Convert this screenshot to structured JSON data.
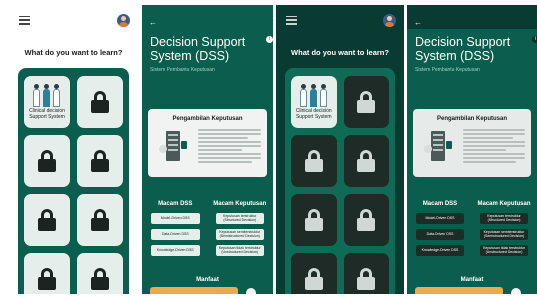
{
  "colors": {
    "primary": "#0b5e4d",
    "primary_dark": "#0a3b32",
    "panel_light": "#0f6a56",
    "tile_light": "#e5eeea",
    "tile_dark": "#1f2b27",
    "card_light": "#f1f3f2",
    "card_dark": "#e6ebe9",
    "text_dark": "#1a1a1a",
    "text_light": "#ffffff",
    "accent_orange": "#f1a84a",
    "sub_text": "#9ed2c4"
  },
  "screens": [
    {
      "theme": "light",
      "menu_icon": "hamburger-icon",
      "avatar_icon": "user-avatar",
      "heading": "What do you want to learn?",
      "tiles": [
        {
          "label": "Clinical decision Support System",
          "icon": "clinicians-illustration",
          "locked": false
        },
        {
          "label": "",
          "icon": "lock-icon",
          "locked": true
        },
        {
          "label": "",
          "icon": "lock-icon",
          "locked": true
        },
        {
          "label": "",
          "icon": "lock-icon",
          "locked": true
        },
        {
          "label": "",
          "icon": "lock-icon",
          "locked": true
        },
        {
          "label": "",
          "icon": "lock-icon",
          "locked": true
        },
        {
          "label": "",
          "icon": "lock-icon",
          "locked": true
        },
        {
          "label": "",
          "icon": "lock-icon",
          "locked": true
        }
      ]
    },
    {
      "theme": "light",
      "back_icon": "back-arrow-icon",
      "title": "Decision Support System (DSS)",
      "subtitle": "Sistem Pembantu Keputusan",
      "card_title": "Pengambilan Keputusan",
      "types_title": "Macam DSS",
      "types": [
        "Model-Driven DSS",
        "Data-Driven DSS",
        "Knowledge-Driven DSS"
      ],
      "decisions_title": "Macam Keputusan",
      "decisions": [
        "Keputusan terstruktur (Structured Decision)",
        "Keputusan semiterstruktur (Semistructured Decision)",
        "Keputusan tidak terstruktur (Unstructured Decision)"
      ],
      "benefits_title": "Manfaat"
    },
    {
      "theme": "dark",
      "menu_icon": "hamburger-icon",
      "avatar_icon": "user-avatar",
      "heading": "What do you want to learn?",
      "tiles": [
        {
          "label": "Clinical decision Support System",
          "icon": "clinicians-illustration",
          "locked": false
        },
        {
          "label": "",
          "icon": "lock-icon",
          "locked": true
        },
        {
          "label": "",
          "icon": "lock-icon",
          "locked": true
        },
        {
          "label": "",
          "icon": "lock-icon",
          "locked": true
        },
        {
          "label": "",
          "icon": "lock-icon",
          "locked": true
        },
        {
          "label": "",
          "icon": "lock-icon",
          "locked": true
        },
        {
          "label": "",
          "icon": "lock-icon",
          "locked": true
        },
        {
          "label": "",
          "icon": "lock-icon",
          "locked": true
        }
      ]
    },
    {
      "theme": "dark",
      "back_icon": "back-arrow-icon",
      "title": "Decision Support System (DSS)",
      "subtitle": "Sistem Pembantu Keputusan",
      "card_title": "Pengambilan Keputusan",
      "types_title": "Macam DSS",
      "types": [
        "Model-Driven DSS",
        "Data-Driven DSS",
        "Knowledge-Driven DSS"
      ],
      "decisions_title": "Macam Keputusan",
      "decisions": [
        "Keputusan terstruktur (Structured Decision)",
        "Keputusan semiterstruktur (Semistructured Decision)",
        "Keputusan tidak terstruktur (Unstructured Decision)"
      ],
      "benefits_title": "Manfaat"
    }
  ]
}
